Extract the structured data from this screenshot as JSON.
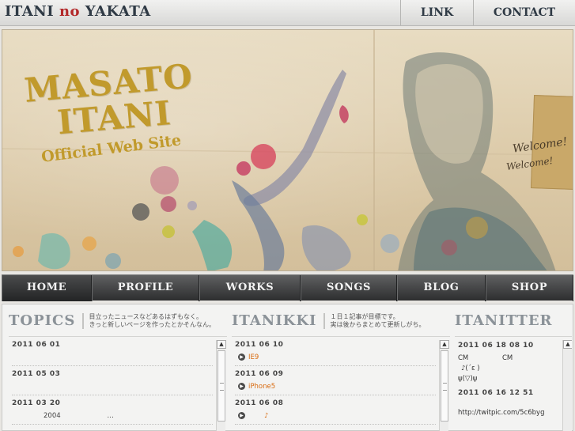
{
  "header": {
    "logo": {
      "part1": "ITANI ",
      "part2": "no",
      "part3": " YAKATA"
    },
    "links": [
      {
        "label": "LINK"
      },
      {
        "label": "CONTACT"
      }
    ]
  },
  "hero": {
    "title_line1": "MASATO",
    "title_line2": "ITANI",
    "subtitle": "Official Web Site",
    "welcome1": "Welcome!",
    "welcome2": "Welcome!"
  },
  "nav": {
    "items": [
      {
        "label": "HOME"
      },
      {
        "label": "PROFILE"
      },
      {
        "label": "WORKS"
      },
      {
        "label": "SONGS"
      },
      {
        "label": "BLOG"
      },
      {
        "label": "SHOP"
      }
    ]
  },
  "topics": {
    "title": "TOPICS",
    "desc_line1": "目立ったニュースなどあるはずもなく。",
    "desc_line2": "きっと新しいページを作ったとかそんなん。",
    "entries": [
      {
        "date": "2011 06 01",
        "text": ""
      },
      {
        "date": "2011 05 03",
        "text": ""
      },
      {
        "date": "2011 03 20",
        "text": "2004",
        "text2": "…"
      }
    ]
  },
  "itanikki": {
    "title": "ITANIKKI",
    "desc_line1": "１日１記事が目標です。",
    "desc_line2": "実は後からまとめて更新しがち。",
    "entries": [
      {
        "date": "2011 06 10",
        "text": "IE9"
      },
      {
        "date": "2011 06 09",
        "text": "iPhone5"
      },
      {
        "date": "2011 06 08",
        "text": "♪"
      }
    ]
  },
  "itanitter": {
    "title": "ITANITTER",
    "entries": [
      {
        "date": "2011 06 18  08 10",
        "col1": "CM",
        "col2": "CM",
        "line2": "♪(´ε )",
        "line3": "ψ(▽)ψ"
      },
      {
        "date": "2011 06 16  12 51",
        "line1": "http://twitpic.com/5c6byg"
      }
    ]
  },
  "colors": {
    "accent_gold": "#c19a2c",
    "logo_red": "#b3292a",
    "nav_dark": "#2d2e2f",
    "link_orange": "#d86a0f"
  }
}
